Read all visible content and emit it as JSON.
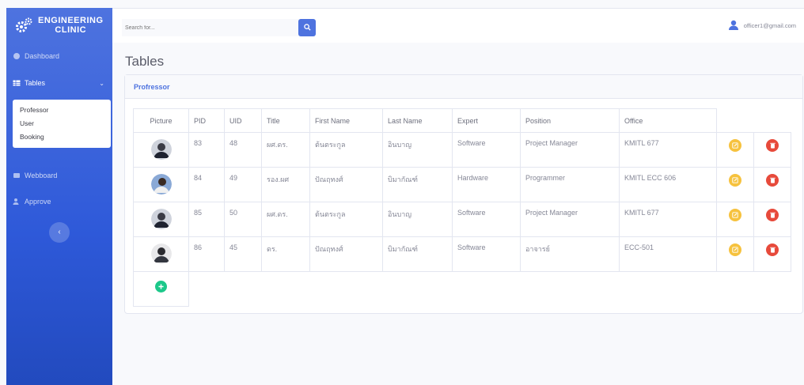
{
  "brand": {
    "line1": "ENGINEERING",
    "line2": "CLINIC"
  },
  "sidebar": {
    "items": [
      {
        "label": "Dashboard",
        "icon": "dashboard-icon"
      },
      {
        "label": "Tables",
        "icon": "table-icon"
      },
      {
        "label": "Webboard",
        "icon": "board-icon"
      },
      {
        "label": "Approve",
        "icon": "user-check-icon"
      }
    ],
    "submenu": [
      "Professor",
      "User",
      "Booking"
    ]
  },
  "topbar": {
    "search_placeholder": "Search for...",
    "user_email": "officer1@gmail.com"
  },
  "page": {
    "title": "Tables"
  },
  "card": {
    "title": "Profressor"
  },
  "table": {
    "headers": [
      "Picture",
      "PID",
      "UID",
      "Title",
      "First Name",
      "Last Name",
      "Expert",
      "Position",
      "Office"
    ],
    "rows": [
      {
        "pid": "83",
        "uid": "48",
        "title": "ผศ.ดร.",
        "first_name": "ต้นตระกูล",
        "last_name": "อินบาญ",
        "expert": "Software",
        "position": "Project Manager",
        "office": "KMITL 677"
      },
      {
        "pid": "84",
        "uid": "49",
        "title": "รอง.ผศ",
        "first_name": "ปัณฤทงศ์",
        "last_name": "บิมากัณฑ์",
        "expert": "Hardware",
        "position": "Programmer",
        "office": "KMITL ECC 606"
      },
      {
        "pid": "85",
        "uid": "50",
        "title": "ผศ.ดร.",
        "first_name": "ต้นตระกูล",
        "last_name": "อินบาญ",
        "expert": "Software",
        "position": "Project Manager",
        "office": "KMITL 677"
      },
      {
        "pid": "86",
        "uid": "45",
        "title": "ดร.",
        "first_name": "ปัณฤทงศ์",
        "last_name": "บิมากัณฑ์",
        "expert": "Software",
        "position": "อาจารย์",
        "office": "ECC-501"
      }
    ]
  },
  "colors": {
    "primary": "#4e73df",
    "edit": "#f6c23e",
    "delete": "#e74a3b",
    "add": "#1cc88a"
  }
}
